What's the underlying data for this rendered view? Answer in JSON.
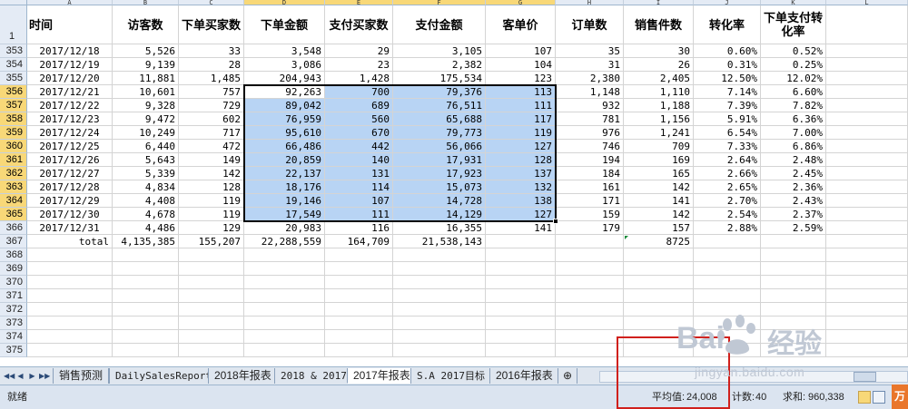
{
  "columns": [
    {
      "letter": "A",
      "header": "时间"
    },
    {
      "letter": "B",
      "header": "访客数"
    },
    {
      "letter": "C",
      "header": "下单买家数"
    },
    {
      "letter": "D",
      "header": "下单金额"
    },
    {
      "letter": "E",
      "header": "支付买家数"
    },
    {
      "letter": "F",
      "header": "支付金额"
    },
    {
      "letter": "G",
      "header": "客单价"
    },
    {
      "letter": "H",
      "header": "订单数"
    },
    {
      "letter": "I",
      "header": "销售件数"
    },
    {
      "letter": "J",
      "header": "转化率"
    },
    {
      "letter": "K",
      "header": "下单支付转化率"
    },
    {
      "letter": "L",
      "header": ""
    }
  ],
  "header_row_number": "1",
  "rows": [
    {
      "n": "353",
      "cells": [
        "2017/12/18",
        "5,526",
        "33",
        "3,548",
        "29",
        "3,105",
        "107",
        "35",
        "30",
        "0.60%",
        "0.52%"
      ]
    },
    {
      "n": "354",
      "cells": [
        "2017/12/19",
        "9,139",
        "28",
        "3,086",
        "23",
        "2,382",
        "104",
        "31",
        "26",
        "0.31%",
        "0.25%"
      ]
    },
    {
      "n": "355",
      "cells": [
        "2017/12/20",
        "11,881",
        "1,485",
        "204,943",
        "1,428",
        "175,534",
        "123",
        "2,380",
        "2,405",
        "12.50%",
        "12.02%"
      ]
    },
    {
      "n": "356",
      "cells": [
        "2017/12/21",
        "10,601",
        "757",
        "92,263",
        "700",
        "79,376",
        "113",
        "1,148",
        "1,110",
        "7.14%",
        "6.60%"
      ]
    },
    {
      "n": "357",
      "cells": [
        "2017/12/22",
        "9,328",
        "729",
        "89,042",
        "689",
        "76,511",
        "111",
        "932",
        "1,188",
        "7.39%",
        "7.82%"
      ]
    },
    {
      "n": "358",
      "cells": [
        "2017/12/23",
        "9,472",
        "602",
        "76,959",
        "560",
        "65,688",
        "117",
        "781",
        "1,156",
        "5.91%",
        "6.36%"
      ]
    },
    {
      "n": "359",
      "cells": [
        "2017/12/24",
        "10,249",
        "717",
        "95,610",
        "670",
        "79,773",
        "119",
        "976",
        "1,241",
        "6.54%",
        "7.00%"
      ]
    },
    {
      "n": "360",
      "cells": [
        "2017/12/25",
        "6,440",
        "472",
        "66,486",
        "442",
        "56,066",
        "127",
        "746",
        "709",
        "7.33%",
        "6.86%"
      ]
    },
    {
      "n": "361",
      "cells": [
        "2017/12/26",
        "5,643",
        "149",
        "20,859",
        "140",
        "17,931",
        "128",
        "194",
        "169",
        "2.64%",
        "2.48%"
      ]
    },
    {
      "n": "362",
      "cells": [
        "2017/12/27",
        "5,339",
        "142",
        "22,137",
        "131",
        "17,923",
        "137",
        "184",
        "165",
        "2.66%",
        "2.45%"
      ]
    },
    {
      "n": "363",
      "cells": [
        "2017/12/28",
        "4,834",
        "128",
        "18,176",
        "114",
        "15,073",
        "132",
        "161",
        "142",
        "2.65%",
        "2.36%"
      ]
    },
    {
      "n": "364",
      "cells": [
        "2017/12/29",
        "4,408",
        "119",
        "19,146",
        "107",
        "14,728",
        "138",
        "171",
        "141",
        "2.70%",
        "2.43%"
      ]
    },
    {
      "n": "365",
      "cells": [
        "2017/12/30",
        "4,678",
        "119",
        "17,549",
        "111",
        "14,129",
        "127",
        "159",
        "142",
        "2.54%",
        "2.37%"
      ]
    },
    {
      "n": "366",
      "cells": [
        "2017/12/31",
        "4,486",
        "129",
        "20,983",
        "116",
        "16,355",
        "141",
        "179",
        "157",
        "2.88%",
        "2.59%"
      ]
    },
    {
      "n": "367",
      "cells": [
        "total",
        "4,135,385",
        "155,207",
        "22,288,559",
        "164,709",
        "21,538,143",
        "",
        "",
        "8725",
        "",
        ""
      ]
    }
  ],
  "empty_rows": [
    "368",
    "369",
    "370",
    "371",
    "372",
    "373",
    "374",
    "375"
  ],
  "sheet_tabs": [
    "销售预测",
    "DailySalesReport",
    "2018年报表",
    "2018 & 2017",
    "2017年报表",
    "S.A 2017目标",
    "2016年报表"
  ],
  "active_tab": "2017年报表",
  "status": {
    "ready": "就绪",
    "average_label": "平均值:",
    "average_value": "24,008",
    "count_label": "计数:",
    "count_value": "40",
    "sum_label": "求和:",
    "sum_value": "960,338"
  },
  "watermark": {
    "brand_left": "Bai",
    "brand_right": "经验",
    "url": "jingyan.baidu.com"
  },
  "colors": {
    "selection": "#b8d4f4",
    "header_highlight": "#f8d878",
    "annotation_box": "#d0201c"
  }
}
